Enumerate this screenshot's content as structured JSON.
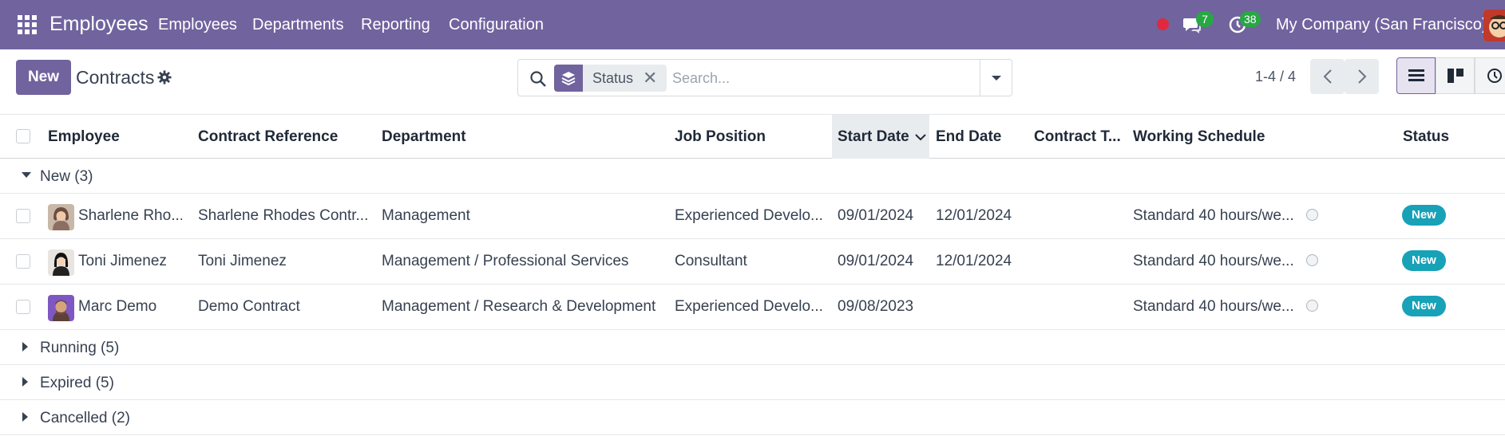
{
  "navbar": {
    "brand": "Employees",
    "menu": [
      "Employees",
      "Departments",
      "Reporting",
      "Configuration"
    ],
    "messages_count": "7",
    "activities_count": "38",
    "company": "My Company (San Francisco)"
  },
  "control": {
    "new_label": "New",
    "title": "Contracts",
    "facet_label": "Status",
    "facet_close": "✕",
    "search_placeholder": "Search...",
    "pager": "1-4 / 4"
  },
  "table": {
    "columns": [
      "Employee",
      "Contract Reference",
      "Department",
      "Job Position",
      "Start Date",
      "End Date",
      "Contract T...",
      "Working Schedule",
      "Status"
    ],
    "groups": [
      {
        "label": "New (3)",
        "expanded": true
      },
      {
        "label": "Running (5)",
        "expanded": false
      },
      {
        "label": "Expired (5)",
        "expanded": false
      },
      {
        "label": "Cancelled (2)",
        "expanded": false
      }
    ],
    "rows": [
      {
        "employee": "Sharlene Rho...",
        "reference": "Sharlene Rhodes Contr...",
        "department": "Management",
        "job": "Experienced Develo...",
        "start": "09/01/2024",
        "end": "12/01/2024",
        "type": "",
        "schedule": "Standard 40 hours/we...",
        "status": "New"
      },
      {
        "employee": "Toni Jimenez",
        "reference": "Toni Jimenez",
        "department": "Management / Professional Services",
        "job": "Consultant",
        "start": "09/01/2024",
        "end": "12/01/2024",
        "type": "",
        "schedule": "Standard 40 hours/we...",
        "status": "New"
      },
      {
        "employee": "Marc Demo",
        "reference": "Demo Contract",
        "department": "Management / Research & Development",
        "job": "Experienced Develo...",
        "start": "09/08/2023",
        "end": "",
        "type": "",
        "schedule": "Standard 40 hours/we...",
        "status": "New"
      }
    ]
  },
  "colors": {
    "brand": "#71639e",
    "status_new": "#17a2b8",
    "notification": "#28a745",
    "record": "#e0293f"
  }
}
